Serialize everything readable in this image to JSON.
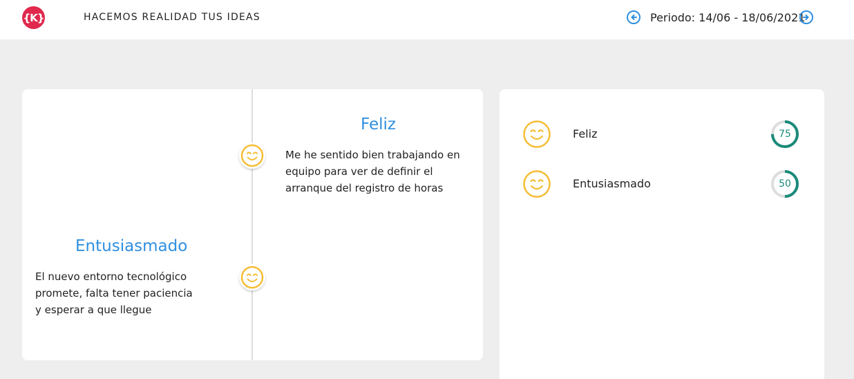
{
  "header": {
    "logo_text": "{K}",
    "brand": "HACEMOS REALIDAD TUS IDEAS",
    "period": "Periodo: 14/06 - 18/06/2021"
  },
  "timeline": {
    "entries": [
      {
        "title": "Feliz",
        "text": "Me he sentido bien trabajando en equipo para ver de definir el arranque del registro de horas",
        "icon": "smile-icon"
      },
      {
        "title": "Entusiasmado",
        "text": "El nuevo entorno tecnológico promete, falta tener paciencia y esperar a que llegue",
        "icon": "smile-icon"
      }
    ]
  },
  "summary": {
    "items": [
      {
        "label": "Feliz",
        "value": 75,
        "value_text": "75",
        "icon": "smile-icon"
      },
      {
        "label": "Entusiasmado",
        "value": 50,
        "value_text": "50",
        "icon": "smile-icon"
      }
    ]
  },
  "colors": {
    "accent": "#2f8fe0",
    "logo": "#e0294d",
    "smile": "#f5bd35",
    "ring_fill": "#1a8a7a",
    "ring_track": "#dddddd"
  }
}
